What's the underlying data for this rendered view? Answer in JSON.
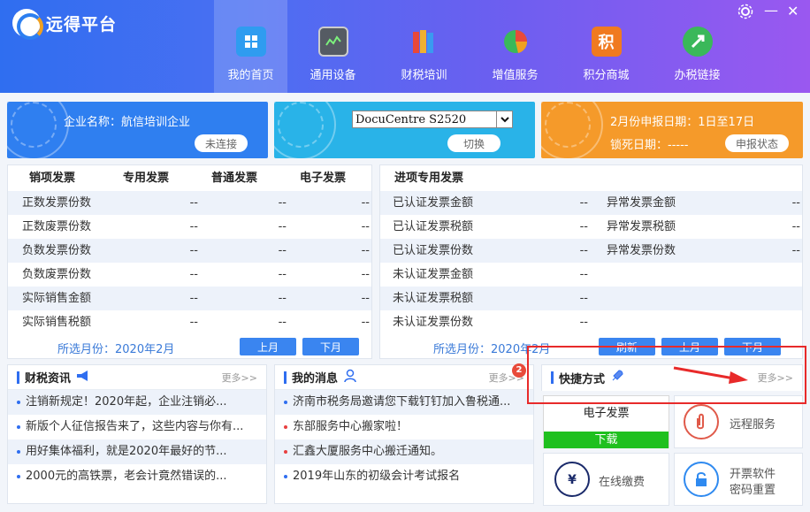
{
  "app": {
    "title": "远得平台",
    "settings_icon": "gear-icon",
    "minimize": "—",
    "close": "✕"
  },
  "nav": [
    {
      "label": "我的首页",
      "icon": "home-grid-icon",
      "color": "#2f9cf0"
    },
    {
      "label": "通用设备",
      "icon": "monitor-icon",
      "color": "#555b63"
    },
    {
      "label": "财税培训",
      "icon": "books-icon",
      "color": "#e0a030"
    },
    {
      "label": "增值服务",
      "icon": "pie-chart-icon",
      "color": "#e04a3a"
    },
    {
      "label": "积分商城",
      "icon": "points-icon",
      "color": "#f07a20",
      "glyph": "积"
    },
    {
      "label": "办税链接",
      "icon": "link-icon",
      "color": "#3ab85a"
    }
  ],
  "cards": {
    "company": {
      "label": "企业名称：航信培训企业",
      "button": "未连接",
      "color": "#2f7ff0"
    },
    "device": {
      "selected": "DocuCentre S2520",
      "button": "切换",
      "color": "#29b3e8"
    },
    "declare": {
      "line1": "2月份申报日期：1日至17日",
      "line2": "锁死日期：-----",
      "button": "申报状态",
      "color": "#f59a2a"
    }
  },
  "sales": {
    "headers": [
      "销项发票",
      "专用发票",
      "普通发票",
      "电子发票"
    ],
    "rows": [
      {
        "label": "正数发票份数",
        "v1": "--",
        "v2": "--",
        "v3": "--"
      },
      {
        "label": "正数废票份数",
        "v1": "--",
        "v2": "--",
        "v3": "--"
      },
      {
        "label": "负数发票份数",
        "v1": "--",
        "v2": "--",
        "v3": "--"
      },
      {
        "label": "负数废票份数",
        "v1": "--",
        "v2": "--",
        "v3": "--"
      },
      {
        "label": "实际销售金额",
        "v1": "--",
        "v2": "--",
        "v3": "--"
      },
      {
        "label": "实际销售税额",
        "v1": "--",
        "v2": "--",
        "v3": "--"
      }
    ],
    "month": "所选月份：2020年2月",
    "prev": "上月",
    "next": "下月"
  },
  "input": {
    "header": "进项专用发票",
    "rows": [
      {
        "label": "已认证发票金额",
        "v1": "--",
        "label2": "异常发票金额",
        "v2": "--"
      },
      {
        "label": "已认证发票税额",
        "v1": "--",
        "label2": "异常发票税额",
        "v2": "--"
      },
      {
        "label": "已认证发票份数",
        "v1": "--",
        "label2": "异常发票份数",
        "v2": "--"
      },
      {
        "label": "未认证发票金额",
        "v1": "--",
        "label2": "",
        "v2": ""
      },
      {
        "label": "未认证发票税额",
        "v1": "--",
        "label2": "",
        "v2": ""
      },
      {
        "label": "未认证发票份数",
        "v1": "--",
        "label2": "",
        "v2": ""
      }
    ],
    "month": "所选月份：2020年2月",
    "refresh": "刷新",
    "prev": "上月",
    "next": "下月"
  },
  "news": {
    "title": "财税资讯",
    "more": "更多>>",
    "items": [
      "注销新规定！2020年起，企业注销必...",
      "新版个人征信报告来了，这些内容与你有...",
      "用好集体福利，就是2020年最好的节...",
      "2000元的高铁票，老会计竟然错误的..."
    ]
  },
  "messages": {
    "title": "我的消息",
    "more": "更多>>",
    "badge": "2",
    "items": [
      {
        "text": "济南市税务局邀请您下载钉钉加入鲁税通...",
        "red": false
      },
      {
        "text": "东部服务中心搬家啦！",
        "red": true
      },
      {
        "text": "汇鑫大厦服务中心搬迁通知。",
        "red": true
      },
      {
        "text": "2019年山东的初级会计考试报名",
        "red": false
      }
    ]
  },
  "shortcuts": {
    "title": "快捷方式",
    "more": "更多>>",
    "einvoice": "电子发票",
    "download": "下载",
    "remote": "远程服务",
    "pay": "在线缴费",
    "reset_line1": "开票软件",
    "reset_line2": "密码重置"
  }
}
